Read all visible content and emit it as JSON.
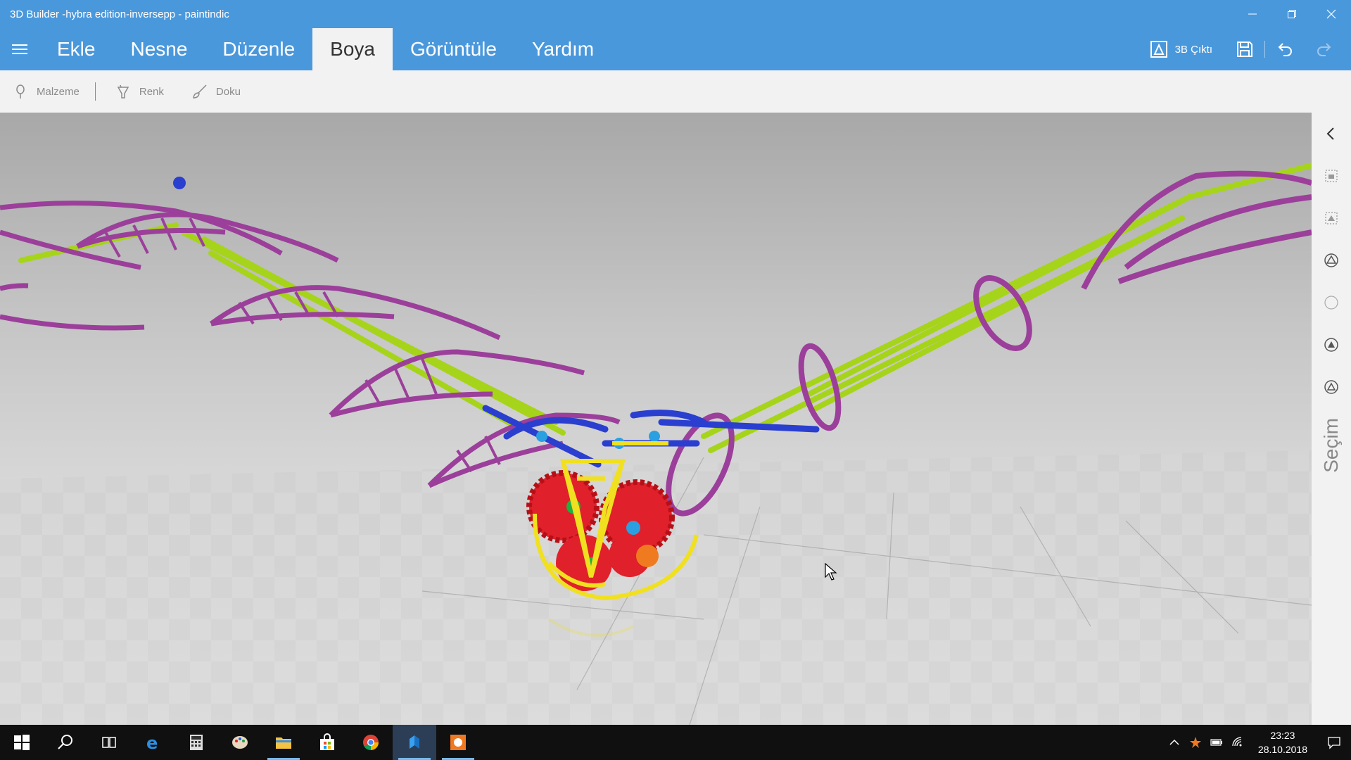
{
  "window": {
    "title": "3D Builder -hybra edition-inversepp - paintindic"
  },
  "menu": {
    "tabs": [
      {
        "label": "Ekle"
      },
      {
        "label": "Nesne"
      },
      {
        "label": "Düzenle"
      },
      {
        "label": "Boya"
      },
      {
        "label": "Görüntüle"
      },
      {
        "label": "Yardım"
      }
    ],
    "active_tab": "Boya",
    "print_label": "3B Çıktı"
  },
  "subtoolbar": {
    "material_label": "Malzeme",
    "color_label": "Renk",
    "texture_label": "Doku"
  },
  "right_panel": {
    "selection_label": "Seçim"
  },
  "scene": {
    "colors": {
      "wing": "#9b3f9b",
      "rod": "#a6d41a",
      "frame": "#2a3fd0",
      "gear": "#e0202a",
      "cage": "#f0e020",
      "joint": "#2aa0e0",
      "hub": "#20b040"
    }
  },
  "taskbar": {
    "apps": [
      {
        "icon": "start-icon"
      },
      {
        "icon": "search-icon"
      },
      {
        "icon": "task-view-icon"
      },
      {
        "icon": "edge-icon"
      },
      {
        "icon": "calculator-icon"
      },
      {
        "icon": "paint-icon"
      },
      {
        "icon": "file-explorer-icon"
      },
      {
        "icon": "store-icon"
      },
      {
        "icon": "chrome-icon"
      },
      {
        "icon": "3d-builder-icon"
      },
      {
        "icon": "orange-app-icon"
      }
    ],
    "time": "23:23",
    "date": "28.10.2018"
  },
  "accent_color": "#4a98dc"
}
